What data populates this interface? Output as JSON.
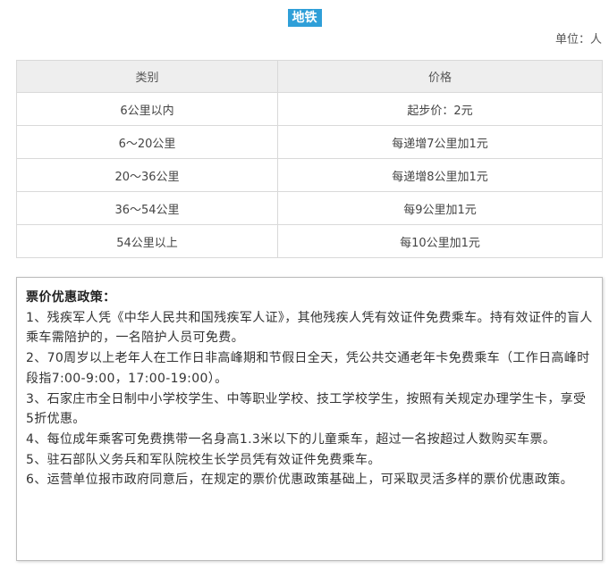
{
  "header": {
    "badge": "地铁",
    "unit": "单位：人"
  },
  "table": {
    "headers": [
      "类别",
      "价格"
    ],
    "rows": [
      [
        "6公里以内",
        "起步价：2元"
      ],
      [
        "6～20公里",
        "每递增7公里加1元"
      ],
      [
        "20～36公里",
        "每递增8公里加1元"
      ],
      [
        "36～54公里",
        "每9公里加1元"
      ],
      [
        "54公里以上",
        "每10公里加1元"
      ]
    ]
  },
  "policy": {
    "title": "票价优惠政策：",
    "items": [
      "1、残疾军人凭《中华人民共和国残疾军人证》，其他残疾人凭有效证件免费乘车。持有效证件的盲人乘车需陪护的，一名陪护人员可免费。",
      "2、70周岁以上老年人在工作日非高峰期和节假日全天，凭公共交通老年卡免费乘车（工作日高峰时段指7:00-9:00，17:00-19:00）。",
      "3、石家庄市全日制中小学校学生、中等职业学校、技工学校学生，按照有关规定办理学生卡，享受5折优惠。",
      "4、每位成年乘客可免费携带一名身高1.3米以下的儿童乘车，超过一名按超过人数购买车票。",
      "5、驻石部队义务兵和军队院校生长学员凭有效证件免费乘车。",
      "6、运营单位报市政府同意后，在规定的票价优惠政策基础上，可采取灵活多样的票价优惠政策。"
    ]
  }
}
